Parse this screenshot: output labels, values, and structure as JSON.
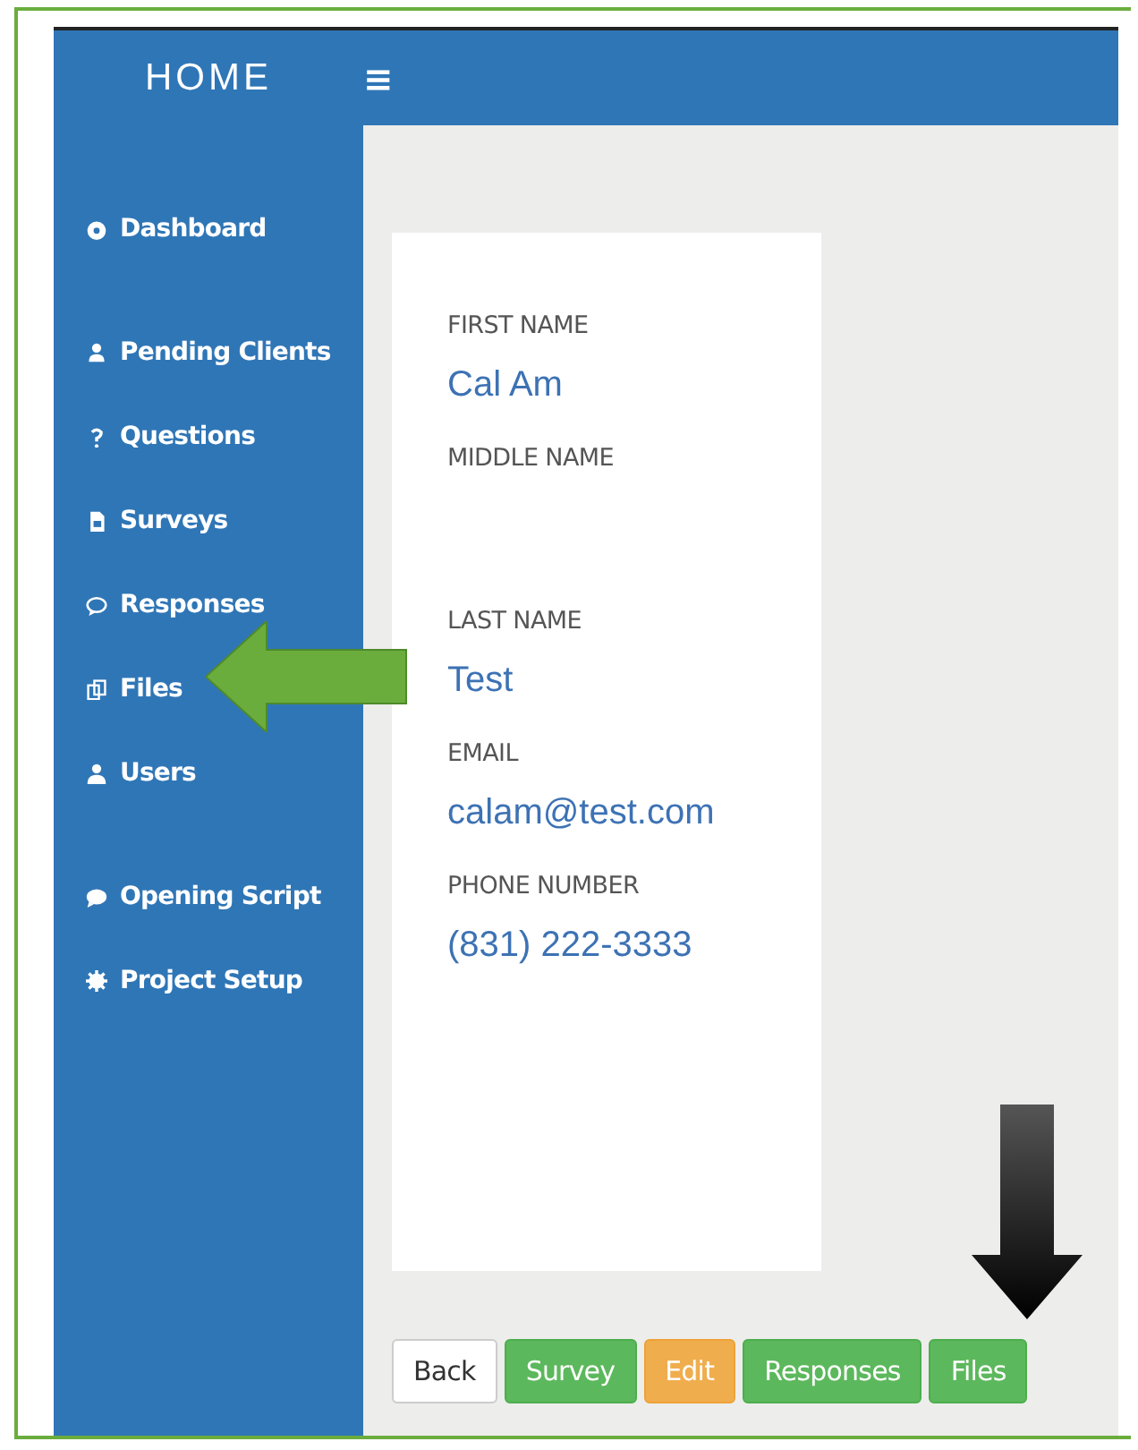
{
  "logo": "HOME",
  "menu_toggle": "≡",
  "sidebar": {
    "groups": [
      [
        {
          "label": "Dashboard"
        }
      ],
      [
        {
          "label": "Pending Clients"
        },
        {
          "label": "Questions"
        },
        {
          "label": "Surveys"
        },
        {
          "label": "Responses"
        },
        {
          "label": "Files"
        },
        {
          "label": "Users"
        }
      ],
      [
        {
          "label": "Opening Script"
        },
        {
          "label": "Project Setup"
        }
      ]
    ]
  },
  "fields": [
    {
      "label": "FIRST NAME",
      "value": "Cal Am"
    },
    {
      "label": "MIDDLE NAME"
    },
    {
      "label": "LAST NAME",
      "value": "Test"
    },
    {
      "label": "EMAIL",
      "value": "calam@test.com"
    },
    {
      "label": "PHONE NUMBER",
      "value": "(831) 222-3333"
    }
  ],
  "buttons": [
    {
      "label": "Back",
      "kind": "default"
    },
    {
      "label": "Survey",
      "kind": "success"
    },
    {
      "label": "Edit",
      "kind": "warning"
    },
    {
      "label": "Responses",
      "kind": "success"
    },
    {
      "label": "Files",
      "kind": "success"
    }
  ]
}
